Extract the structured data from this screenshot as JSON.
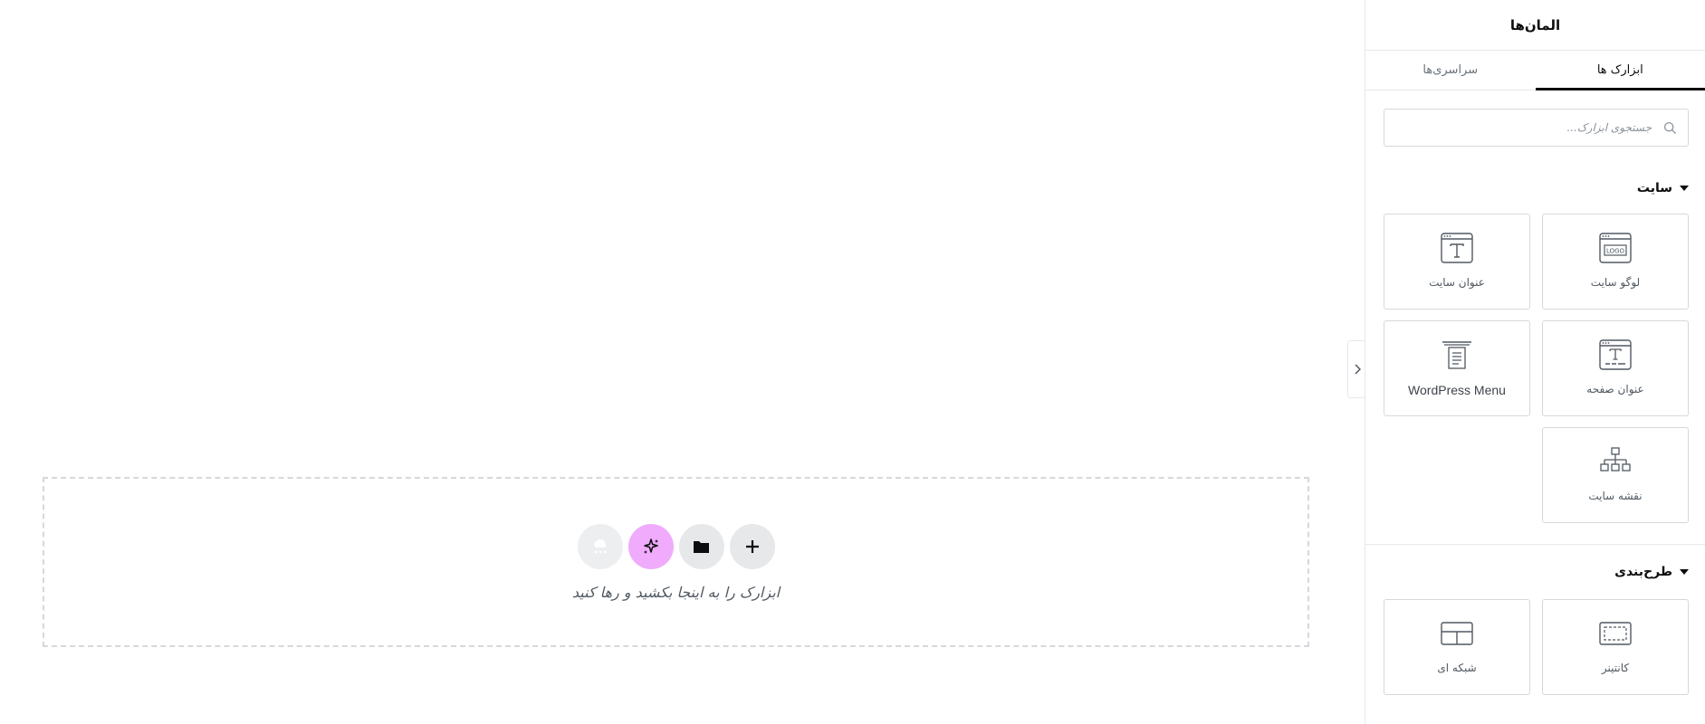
{
  "panel": {
    "title": "المان‌ها",
    "tabs": [
      {
        "label": "ابزارک ها",
        "active": true
      },
      {
        "label": "سراسری‌ها",
        "active": false
      }
    ],
    "search": {
      "placeholder": "جستجوی ابزارک...",
      "value": ""
    }
  },
  "sections": [
    {
      "title": "سایت",
      "widgets": [
        {
          "label": "لوگو سایت",
          "icon": "site-logo-icon"
        },
        {
          "label": "عنوان سایت",
          "icon": "site-title-icon"
        },
        {
          "label": "عنوان صفحه",
          "icon": "page-title-icon"
        },
        {
          "label": "WordPress Menu",
          "icon": "wordpress-menu-icon"
        },
        {
          "label": "نقشه سایت",
          "icon": "sitemap-icon"
        }
      ]
    },
    {
      "title": "طرح‌بندی",
      "widgets": [
        {
          "label": "کانتینر",
          "icon": "container-icon"
        },
        {
          "label": "شبکه ای",
          "icon": "grid-icon"
        }
      ]
    }
  ],
  "canvas": {
    "dropzone_hint": "ابزارک را به اینجا بکشید و رها کنید",
    "buttons": [
      {
        "icon": "plus-icon"
      },
      {
        "icon": "folder-icon"
      },
      {
        "icon": "ai-sparkle-icon",
        "color": "#f0abfc"
      },
      {
        "icon": "cloud-icon"
      }
    ]
  },
  "colors": {
    "accent_ai": "#f0abfc",
    "border": "#d5d8dc",
    "text": "#515962"
  }
}
